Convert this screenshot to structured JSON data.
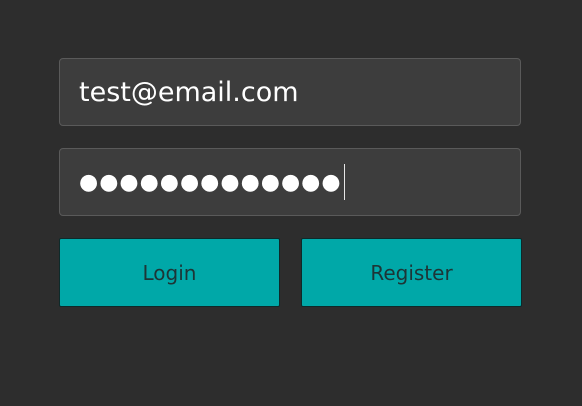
{
  "form": {
    "email_value": "test@email.com",
    "password_masked": "●●●●●●●●●●●●●",
    "login_label": "Login",
    "register_label": "Register"
  },
  "colors": {
    "background": "#2d2d2d",
    "field_background": "#3d3d3d",
    "field_border": "#5a5a5a",
    "accent": "#00a8a8",
    "button_text": "#1d3536",
    "field_text": "#ffffff"
  }
}
